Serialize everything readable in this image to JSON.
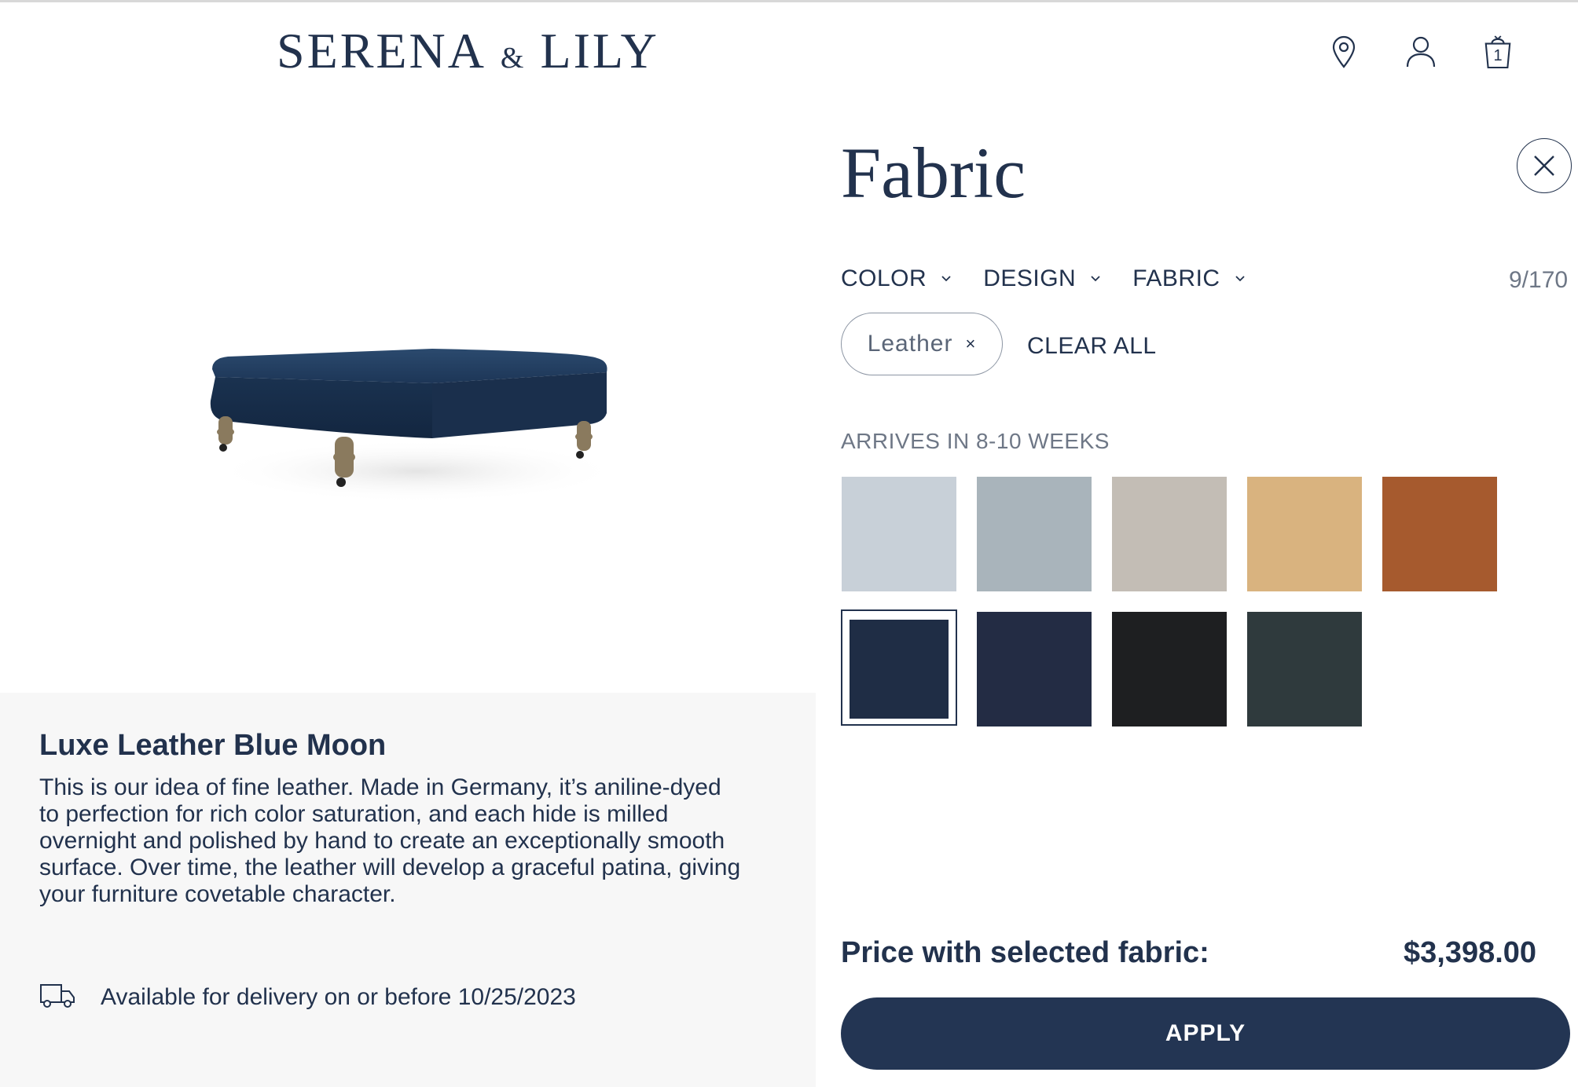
{
  "header": {
    "logo_left": "SERENA",
    "logo_amp": "&",
    "logo_right": "LILY",
    "icons": [
      "location-pin-icon",
      "account-icon",
      "cart-icon"
    ],
    "cart_count": "1"
  },
  "product": {
    "image": "navy-leather-ottoman-image",
    "fabric_name": "Luxe Leather Blue Moon",
    "description": "This is our idea of fine leather. Made in Germany, it’s aniline-dyed to perfection for rich color saturation, and each hide is milled overnight and polished by hand to create an exceptionally smooth surface. Over time, the leather will develop a graceful patina, giving your furniture covetable character.",
    "delivery": "Available for delivery on or before 10/25/2023"
  },
  "panel": {
    "title": "Fabric",
    "filters": [
      {
        "label": "COLOR"
      },
      {
        "label": "DESIGN"
      },
      {
        "label": "FABRIC"
      }
    ],
    "count": "9/170",
    "active_chip": "Leather",
    "clear_all": "CLEAR ALL",
    "arrives": "ARRIVES IN 8-10 WEEKS",
    "swatches": [
      {
        "color": "#c8d0d8"
      },
      {
        "color": "#a9b4bb"
      },
      {
        "color": "#c3bdb5"
      },
      {
        "color": "#d9b37f"
      },
      {
        "color": "#a65a2e"
      },
      {
        "color": "#1f2d45",
        "selected": true
      },
      {
        "color": "#232c44"
      },
      {
        "color": "#1e1f21"
      },
      {
        "color": "#2f3a3d"
      }
    ],
    "price_label": "Price with selected fabric:",
    "price_value": "$3,398.00",
    "apply": "APPLY"
  },
  "colors": {
    "navy": "#22324d",
    "button": "#233553",
    "panel_bg": "#f7f7f7"
  }
}
